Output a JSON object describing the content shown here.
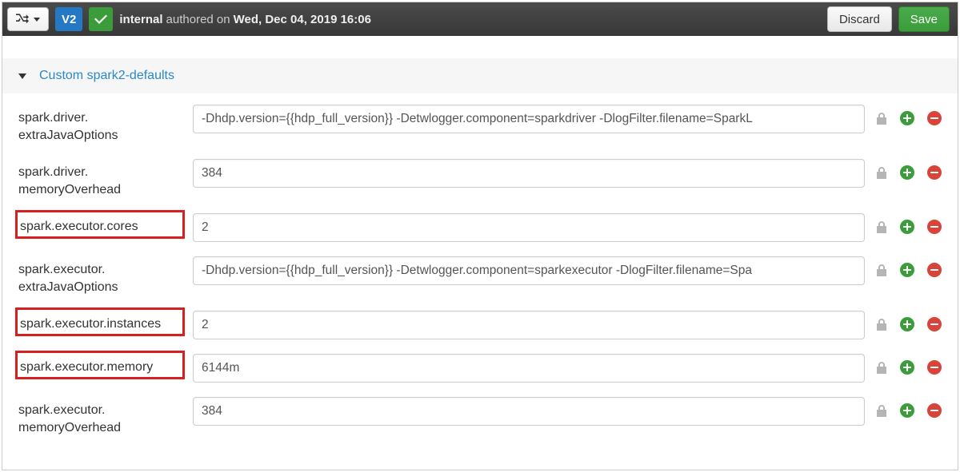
{
  "topbar": {
    "version_badge": "V2",
    "status_user": "internal",
    "authored_text": "authored on",
    "authored_date": "Wed, Dec 04, 2019 16:06",
    "discard_label": "Discard",
    "save_label": "Save"
  },
  "section": {
    "title": "Custom spark2-defaults"
  },
  "properties": [
    {
      "key": "spark.driver. extraJavaOptions",
      "value": "-Dhdp.version={{hdp_full_version}} -Detwlogger.component=sparkdriver -DlogFilter.filename=SparkL",
      "highlighted": false
    },
    {
      "key": "spark.driver. memoryOverhead",
      "value": "384",
      "highlighted": false
    },
    {
      "key": "spark.executor.cores",
      "value": "2",
      "highlighted": true
    },
    {
      "key": "spark.executor. extraJavaOptions",
      "value": "-Dhdp.version={{hdp_full_version}} -Detwlogger.component=sparkexecutor -DlogFilter.filename=Spa",
      "highlighted": false
    },
    {
      "key": "spark.executor.instances",
      "value": "2",
      "highlighted": true
    },
    {
      "key": "spark.executor.memory",
      "value": "6144m",
      "highlighted": true
    },
    {
      "key": "spark.executor. memoryOverhead",
      "value": "384",
      "highlighted": false
    }
  ]
}
